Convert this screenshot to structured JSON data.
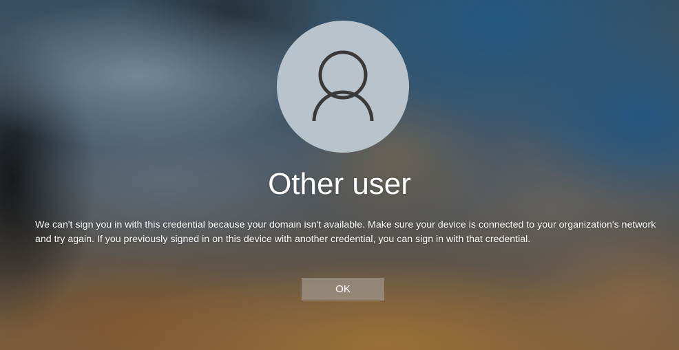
{
  "screen": {
    "type": "windows-sign-in",
    "accent_color": "#b8c3cc"
  },
  "user": {
    "avatar_icon": "person-silhouette-icon",
    "name": "Other user"
  },
  "message": {
    "text": "We can't sign you in with this credential because your domain isn't available. Make sure your device is connected to your organization's network and try again. If you previously signed in on this device with another credential, you can sign in with that credential."
  },
  "actions": {
    "ok_label": "OK"
  }
}
